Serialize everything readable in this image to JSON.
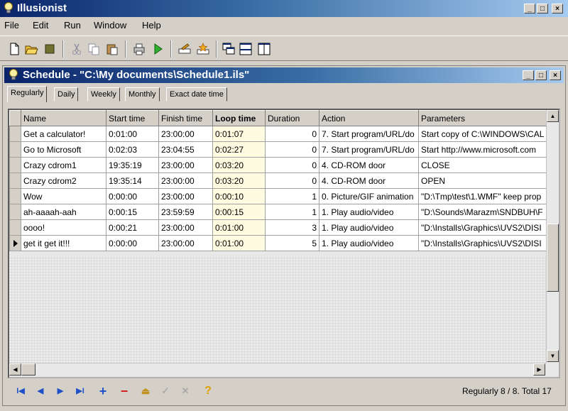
{
  "app": {
    "title": "Illusionist"
  },
  "window_controls": {
    "minimize": "_",
    "maximize": "□",
    "close": "×"
  },
  "menu": [
    {
      "label": "File"
    },
    {
      "label": "Edit"
    },
    {
      "label": "Run"
    },
    {
      "label": "Window"
    },
    {
      "label": "Help"
    }
  ],
  "toolbar": {
    "icons": [
      "new-document-icon",
      "open-folder-icon",
      "stop-icon",
      "cut-icon",
      "copy-icon",
      "paste-icon",
      "print-icon",
      "run-icon",
      "edit-icon",
      "magic-icon",
      "cascade-windows-icon",
      "tile-horizontal-icon",
      "tile-vertical-icon"
    ]
  },
  "schedule_window": {
    "title": "Schedule - \"C:\\My documents\\Schedule1.ils\""
  },
  "tabs": [
    {
      "label": "Regularly",
      "active": true
    },
    {
      "label": "Daily"
    },
    {
      "label": "Weekly"
    },
    {
      "label": "Monthly"
    },
    {
      "label": "Exact date time"
    }
  ],
  "grid": {
    "columns": [
      "Name",
      "Start time",
      "Finish time",
      "Loop time",
      "Duration",
      "Action",
      "Parameters"
    ],
    "rows": [
      [
        "Get a calculator!",
        "0:01:00",
        "23:00:00",
        "0:01:07",
        "0",
        "7. Start program/URL/do",
        "Start copy of C:\\WINDOWS\\CAL"
      ],
      [
        "Go to Microsoft",
        "0:02:03",
        "23:04:55",
        "0:02:27",
        "0",
        "7. Start program/URL/do",
        "Start http://www.microsoft.com"
      ],
      [
        "Crazy cdrom1",
        "19:35:19",
        "23:00:00",
        "0:03:20",
        "0",
        "4. CD-ROM door",
        "CLOSE"
      ],
      [
        "Crazy cdrom2",
        "19:35:14",
        "23:00:00",
        "0:03:20",
        "0",
        "4. CD-ROM door",
        "OPEN"
      ],
      [
        "Wow",
        "0:00:00",
        "23:00:00",
        "0:00:10",
        "1",
        "0. Picture/GIF animation",
        "\"D:\\Tmp\\test\\1.WMF\" keep prop"
      ],
      [
        "ah-aaaah-aah",
        "0:00:15",
        "23:59:59",
        "0:00:15",
        "1",
        "1. Play audio/video",
        "\"D:\\Sounds\\Marazm\\SNDBUH\\F"
      ],
      [
        "oooo!",
        "0:00:21",
        "23:00:00",
        "0:01:00",
        "3",
        "1. Play audio/video",
        "\"D:\\Installs\\Graphics\\UVS2\\DISI"
      ],
      [
        "get it get it!!!",
        "0:00:00",
        "23:00:00",
        "0:01:00",
        "5",
        "1. Play audio/video",
        "\"D:\\Installs\\Graphics\\UVS2\\DISI"
      ]
    ],
    "current_row": 7
  },
  "navigator": {
    "icons": [
      "first-record-icon",
      "prior-record-icon",
      "next-record-icon",
      "last-record-icon",
      "insert-record-icon",
      "delete-record-icon",
      "edit-record-icon",
      "post-record-icon",
      "cancel-record-icon",
      "help-icon"
    ],
    "glyphs": [
      "I◀",
      "◀",
      "▶",
      "▶I",
      "+",
      "−",
      "⏏",
      "✓",
      "✕",
      "?"
    ]
  },
  "status": {
    "text": "Regularly 8 / 8.  Total 17"
  },
  "colors": {
    "title_active": "#0a246a",
    "title_gradient_end": "#a6caf0",
    "nav_icons": "#2050c8",
    "delete_red": "#d02020"
  }
}
